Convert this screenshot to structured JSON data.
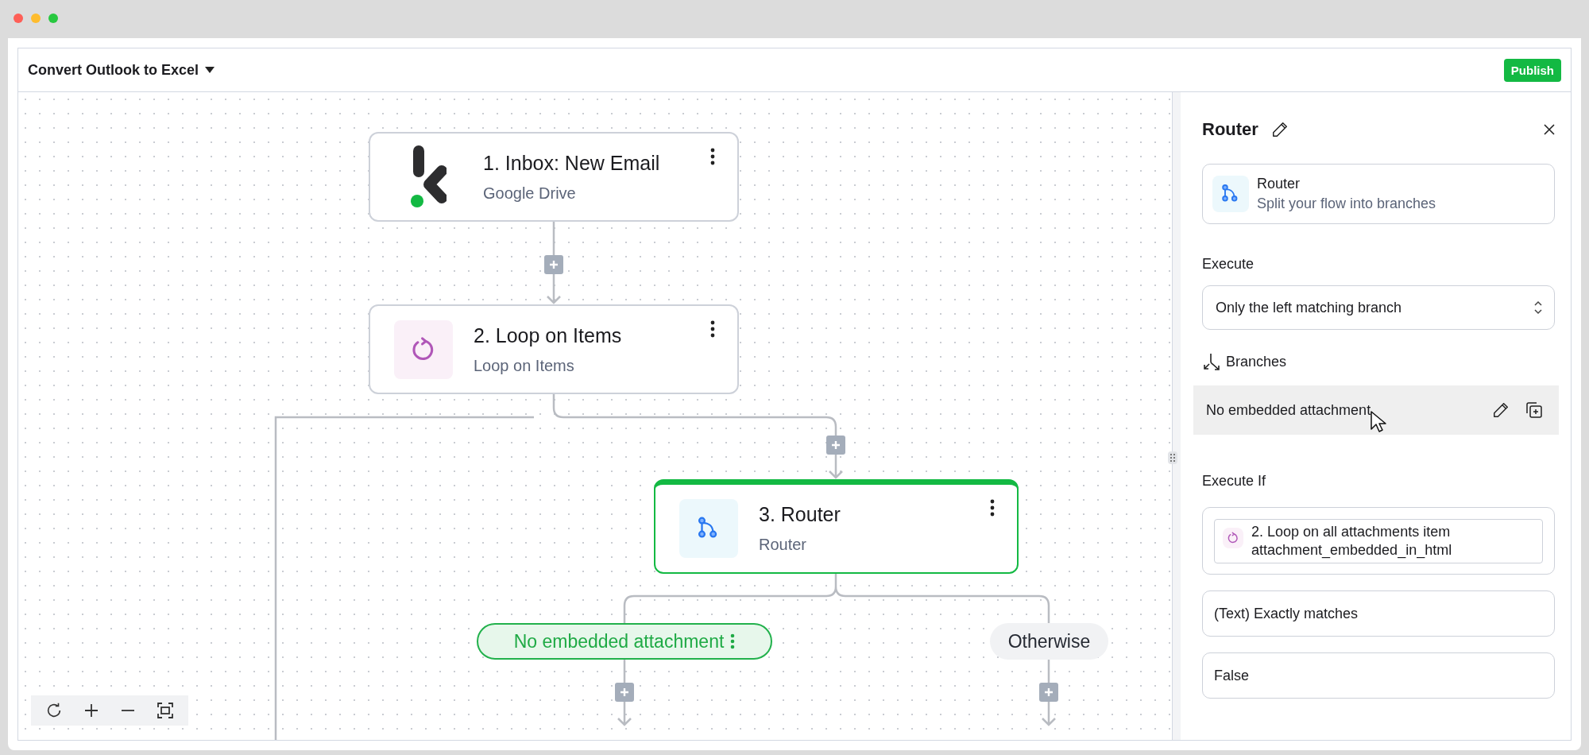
{
  "window": {
    "title": "Convert Outlook to Excel",
    "publish_button": "Publish"
  },
  "canvas": {
    "steps": [
      {
        "kind": "trigger",
        "title": "1. Inbox: New Email",
        "subtitle": "Google Drive",
        "selected": false
      },
      {
        "kind": "loop",
        "title": "2. Loop on Items",
        "subtitle": "Loop on Items",
        "selected": false
      },
      {
        "kind": "router",
        "title": "3. Router",
        "subtitle": "Router",
        "selected": true
      }
    ],
    "branches": [
      {
        "label": "No embedded attachment",
        "selected": true
      },
      {
        "label": "Otherwise",
        "selected": false
      }
    ]
  },
  "panel": {
    "title": "Router",
    "step_card": {
      "title": "Router",
      "description": "Split your flow into branches"
    },
    "execute": {
      "label": "Execute",
      "value": "Only the left matching branch"
    },
    "branches": {
      "label": "Branches",
      "items": [
        {
          "label": "No embedded attachment",
          "highlighted": true
        }
      ]
    },
    "execute_if": {
      "label": "Execute If",
      "conditions": [
        {
          "kind": "variable",
          "step": "2. Loop on all attachments item",
          "field": "attachment_embedded_in_html"
        },
        {
          "kind": "text",
          "value": "(Text) Exactly matches"
        },
        {
          "kind": "text",
          "value": "False"
        }
      ]
    }
  }
}
